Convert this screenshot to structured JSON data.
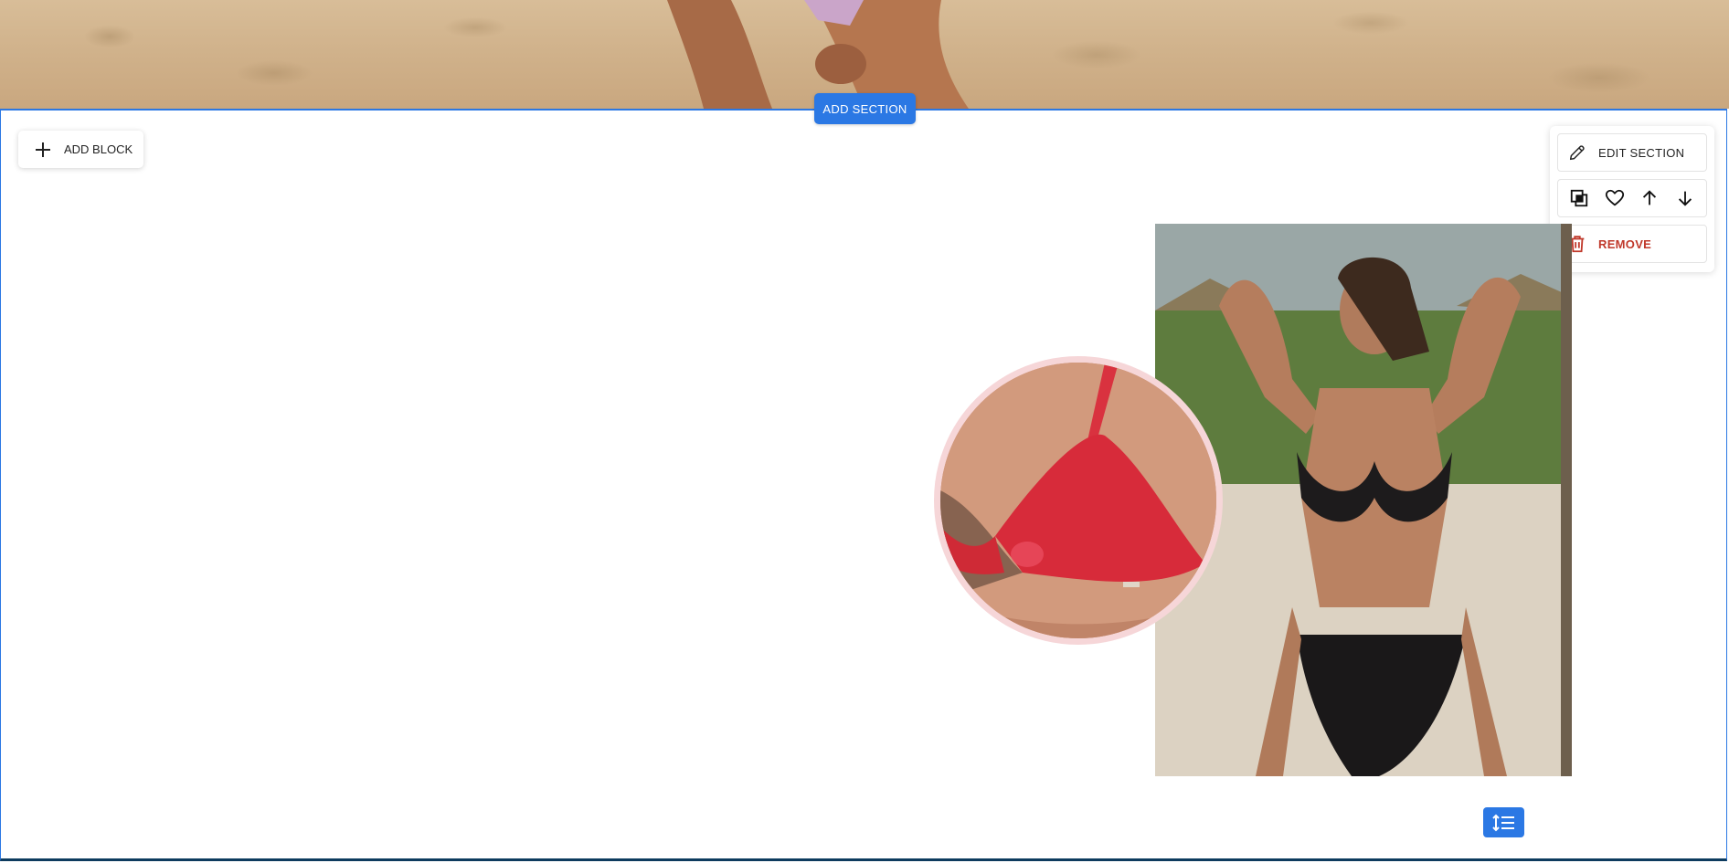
{
  "section": {
    "add_section_label": "ADD SECTION",
    "add_block_label": "ADD BLOCK"
  },
  "toolbar": {
    "edit_label": "EDIT SECTION",
    "remove_label": "REMOVE",
    "icons": [
      "duplicate-icon",
      "heart-icon",
      "arrow-up-icon",
      "arrow-down-icon"
    ]
  },
  "images": {
    "hero": "beach-sand-photo",
    "main": "black-bikini-photo",
    "circle": "red-bikini-closeup-photo"
  },
  "colors": {
    "accent": "#2b78e4",
    "danger": "#c0392b",
    "circle_border": "#f6d6d8"
  },
  "layout_button_icon": "line-height-icon"
}
